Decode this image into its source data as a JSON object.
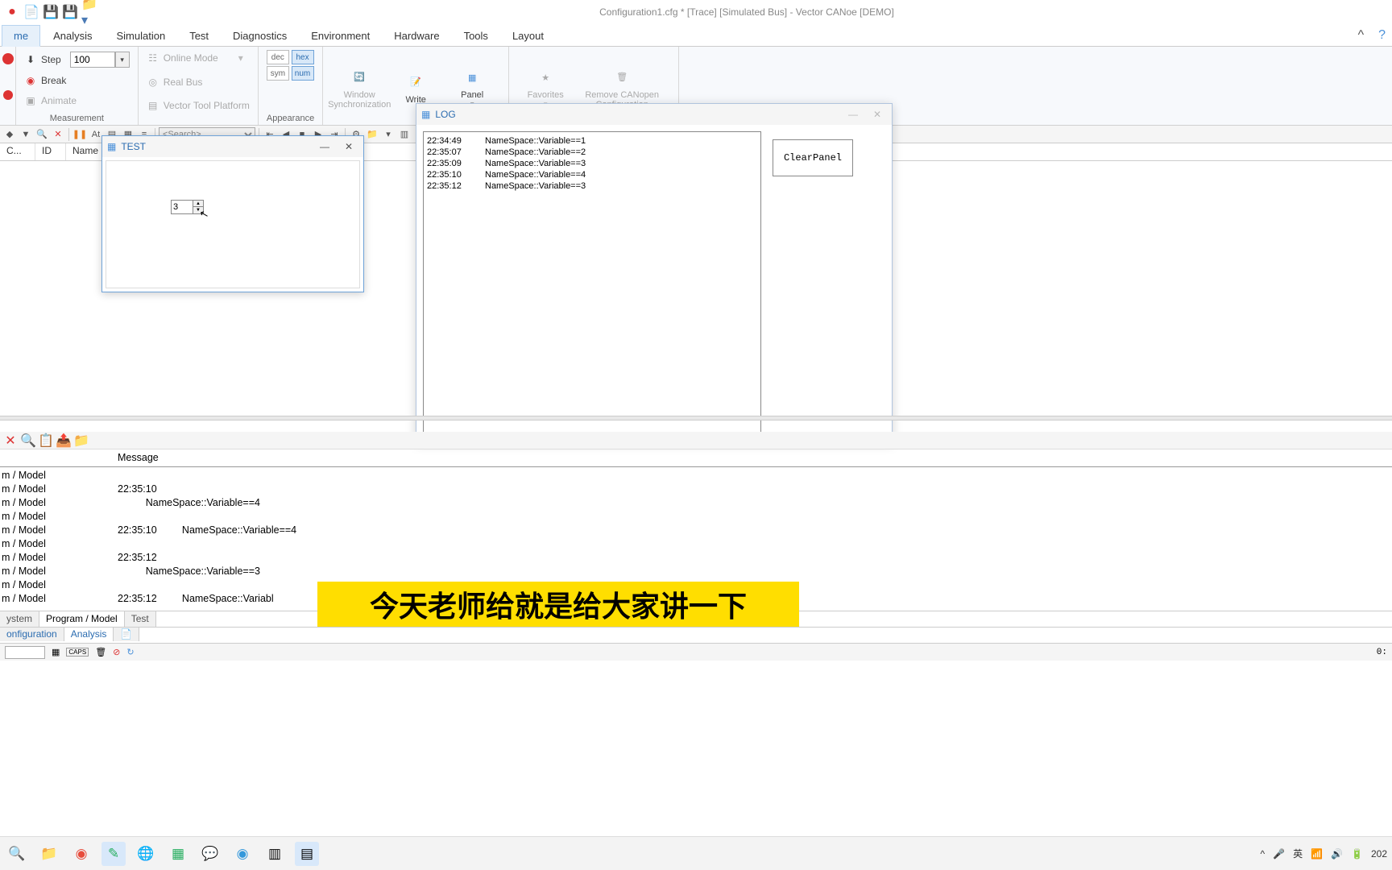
{
  "app_title": "Configuration1.cfg * [Trace] [Simulated Bus] - Vector CANoe [DEMO]",
  "ribbon_tabs": [
    "me",
    "Analysis",
    "Simulation",
    "Test",
    "Diagnostics",
    "Environment",
    "Hardware",
    "Tools",
    "Layout"
  ],
  "measurement": {
    "step": "Step",
    "step_val": "100",
    "break": "Break",
    "animate": "Animate",
    "label": "Measurement"
  },
  "mode": {
    "online": "Online Mode",
    "realbus": "Real Bus",
    "vtp": "Vector Tool Platform"
  },
  "appearance": {
    "dec": "dec",
    "hex": "hex",
    "sym": "sym",
    "num": "num",
    "label": "Appearance"
  },
  "bigbuttons": {
    "winsync": "Window Synchronization",
    "write": "Write",
    "panel": "Panel",
    "fav": "Favorites",
    "remove": "Remove CANopen Configuration"
  },
  "trace_columns": [
    "C...",
    "ID",
    "Name"
  ],
  "search_placeholder": "<Search>",
  "panel_test": {
    "title": "TEST",
    "value": "3"
  },
  "panel_log": {
    "title": "LOG",
    "rows": [
      {
        "ts": "22:34:49",
        "msg": "NameSpace::Variable==1"
      },
      {
        "ts": "22:35:07",
        "msg": "NameSpace::Variable==2"
      },
      {
        "ts": "22:35:09",
        "msg": "NameSpace::Variable==3"
      },
      {
        "ts": "22:35:10",
        "msg": "NameSpace::Variable==4"
      },
      {
        "ts": "22:35:12",
        "msg": "NameSpace::Variable==3"
      }
    ],
    "clear": "ClearPanel"
  },
  "write": {
    "header_msg": "Message",
    "rows": [
      {
        "src": "m / Model",
        "msg": ""
      },
      {
        "src": "m / Model",
        "msg": "22:35:10"
      },
      {
        "src": "m / Model",
        "msg": "          NameSpace::Variable==4"
      },
      {
        "src": "m / Model",
        "msg": ""
      },
      {
        "src": "m / Model",
        "msg": "22:35:10         NameSpace::Variable==4"
      },
      {
        "src": "m / Model",
        "msg": ""
      },
      {
        "src": "m / Model",
        "msg": "22:35:12"
      },
      {
        "src": "m / Model",
        "msg": "          NameSpace::Variable==3"
      },
      {
        "src": "m / Model",
        "msg": ""
      },
      {
        "src": "m / Model",
        "msg": "22:35:12         NameSpace::Variabl"
      }
    ]
  },
  "bottom_tabs": [
    "ystem",
    "Program / Model",
    "Test"
  ],
  "bottom_tabs2": [
    "onfiguration",
    "Analysis"
  ],
  "status_time": "0:",
  "subtitle": "今天老师给就是给大家讲一下",
  "tray": {
    "ime": "英",
    "time": "202"
  }
}
